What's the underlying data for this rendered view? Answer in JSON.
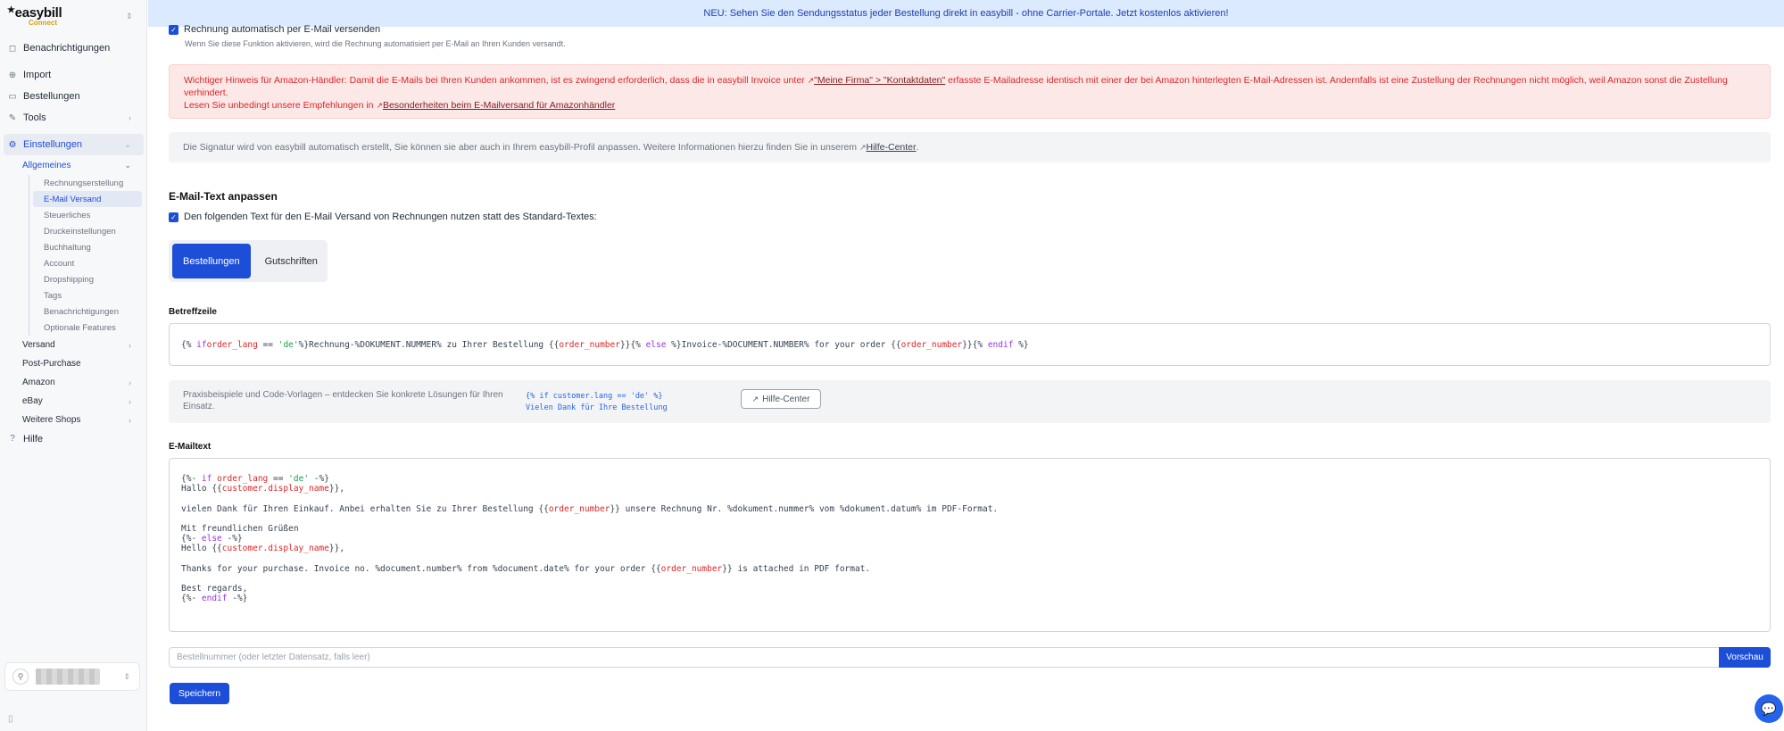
{
  "brand": {
    "name": "easybill",
    "sub": "Connect"
  },
  "banner": "NEU: Sehen Sie den Sendungsstatus jeder Bestellung direkt in easybill - ohne Carrier-Portale. Jetzt kostenlos aktivieren!",
  "sidebar": {
    "items": [
      {
        "label": "Benachrichtigungen",
        "icon": "bell-icon"
      },
      {
        "label": "Import",
        "icon": "import-icon"
      },
      {
        "label": "Bestellungen",
        "icon": "orders-icon"
      },
      {
        "label": "Tools",
        "icon": "tools-icon"
      },
      {
        "label": "Einstellungen",
        "icon": "settings-icon"
      }
    ],
    "settings_group": {
      "label": "Allgemeines",
      "items": [
        "Rechnungserstellung",
        "E-Mail Versand",
        "Steuerliches",
        "Druckeinstellungen",
        "Buchhaltung",
        "Account",
        "Dropshipping",
        "Tags",
        "Benachrichtigungen",
        "Optionale Features"
      ]
    },
    "more": [
      "Versand",
      "Post-Purchase",
      "Amazon",
      "eBay",
      "Weitere Shops"
    ],
    "help": "Hilfe"
  },
  "main": {
    "auto_send_label": "Rechnung automatisch per E-Mail versenden",
    "auto_send_help": "Wenn Sie diese Funktion aktivieren, wird die Rechnung automatisiert per E-Mail an Ihren Kunden versandt.",
    "amazon_alert": {
      "line1_a": "Wichtiger Hinweis für Amazon-Händler: Damit die E-Mails bei Ihren Kunden ankommen, ist es zwingend erforderlich, dass die in easybill Invoice unter ",
      "line1_link": "\"Meine Firma\" > \"Kontaktdaten\"",
      "line1_b": " erfasste E-Mailadresse identisch mit einer der bei Amazon hinterlegten E-Mail-Adressen ist. Andernfalls ist eine Zustellung der Rechnungen nicht möglich, weil Amazon sonst die Zustellung verhindert.",
      "line2_a": "Lesen Sie unbedingt unsere Empfehlungen in ",
      "line2_link": "Besonderheiten beim E-Mailversand für Amazonhändler"
    },
    "signature_note": "Die Signatur wird von easybill automatisch erstellt, Sie können sie aber auch in Ihrem easybill-Profil anpassen. Weitere Informationen hierzu finden Sie in unserem ",
    "signature_link": "Hilfe-Center",
    "email_text_title": "E-Mail-Text anpassen",
    "custom_text_label": "Den folgenden Text für den E-Mail Versand von Rechnungen nutzen statt des Standard-Textes:",
    "tabs": [
      "Bestellungen",
      "Gutschriften"
    ],
    "subject_label": "Betreffzeile",
    "hint_text": "Praxisbeispiele und Code-Vorlagen – entdecken Sie konkrete Lösungen für Ihren Einsatz.",
    "hint_code_1": "{% if customer.lang == 'de' %}",
    "hint_code_2": "Vielen Dank für Ihre Bestellung",
    "hint_button": "Hilfe-Center",
    "mail_label": "E-Mailtext",
    "preview_placeholder": "Bestellnummer (oder letzter Datensatz, falls leer)",
    "preview_button": "Vorschau",
    "save_button": "Speichern"
  },
  "colors": {
    "primary": "#1d4ed8",
    "danger": "#dc2626",
    "banner_bg": "#dbeafe"
  }
}
